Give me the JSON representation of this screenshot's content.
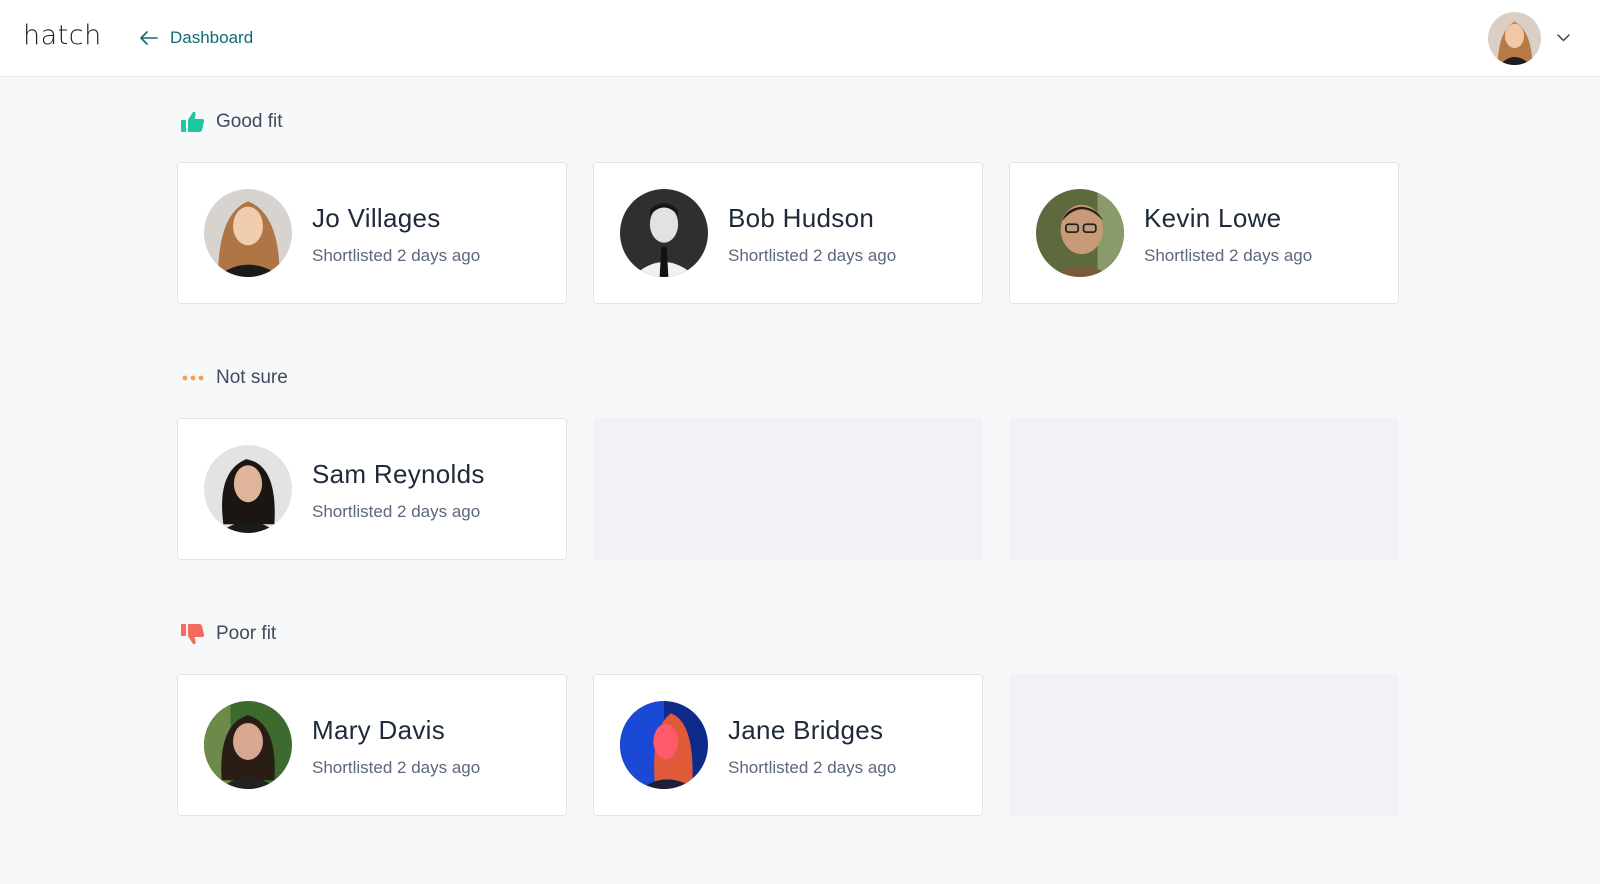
{
  "header": {
    "logo": "hatch",
    "back_label": "Dashboard"
  },
  "sections": [
    {
      "title": "Good fit",
      "icon": "thumbs-up-icon",
      "color": "#1fc7a0",
      "candidates": [
        {
          "name": "Jo Villages",
          "status": "Shortlisted 2 days ago"
        },
        {
          "name": "Bob Hudson",
          "status": "Shortlisted 2 days ago"
        },
        {
          "name": "Kevin Lowe",
          "status": "Shortlisted 2 days ago"
        }
      ]
    },
    {
      "title": "Not sure",
      "icon": "ellipsis-icon",
      "color": "#f5a04a",
      "candidates": [
        {
          "name": "Sam Reynolds",
          "status": "Shortlisted 2 days ago"
        }
      ]
    },
    {
      "title": "Poor fit",
      "icon": "thumbs-down-icon",
      "color": "#f26b5b",
      "candidates": [
        {
          "name": "Mary Davis",
          "status": "Shortlisted 2 days ago"
        },
        {
          "name": "Jane Bridges",
          "status": "Shortlisted 2 days ago"
        }
      ]
    }
  ]
}
